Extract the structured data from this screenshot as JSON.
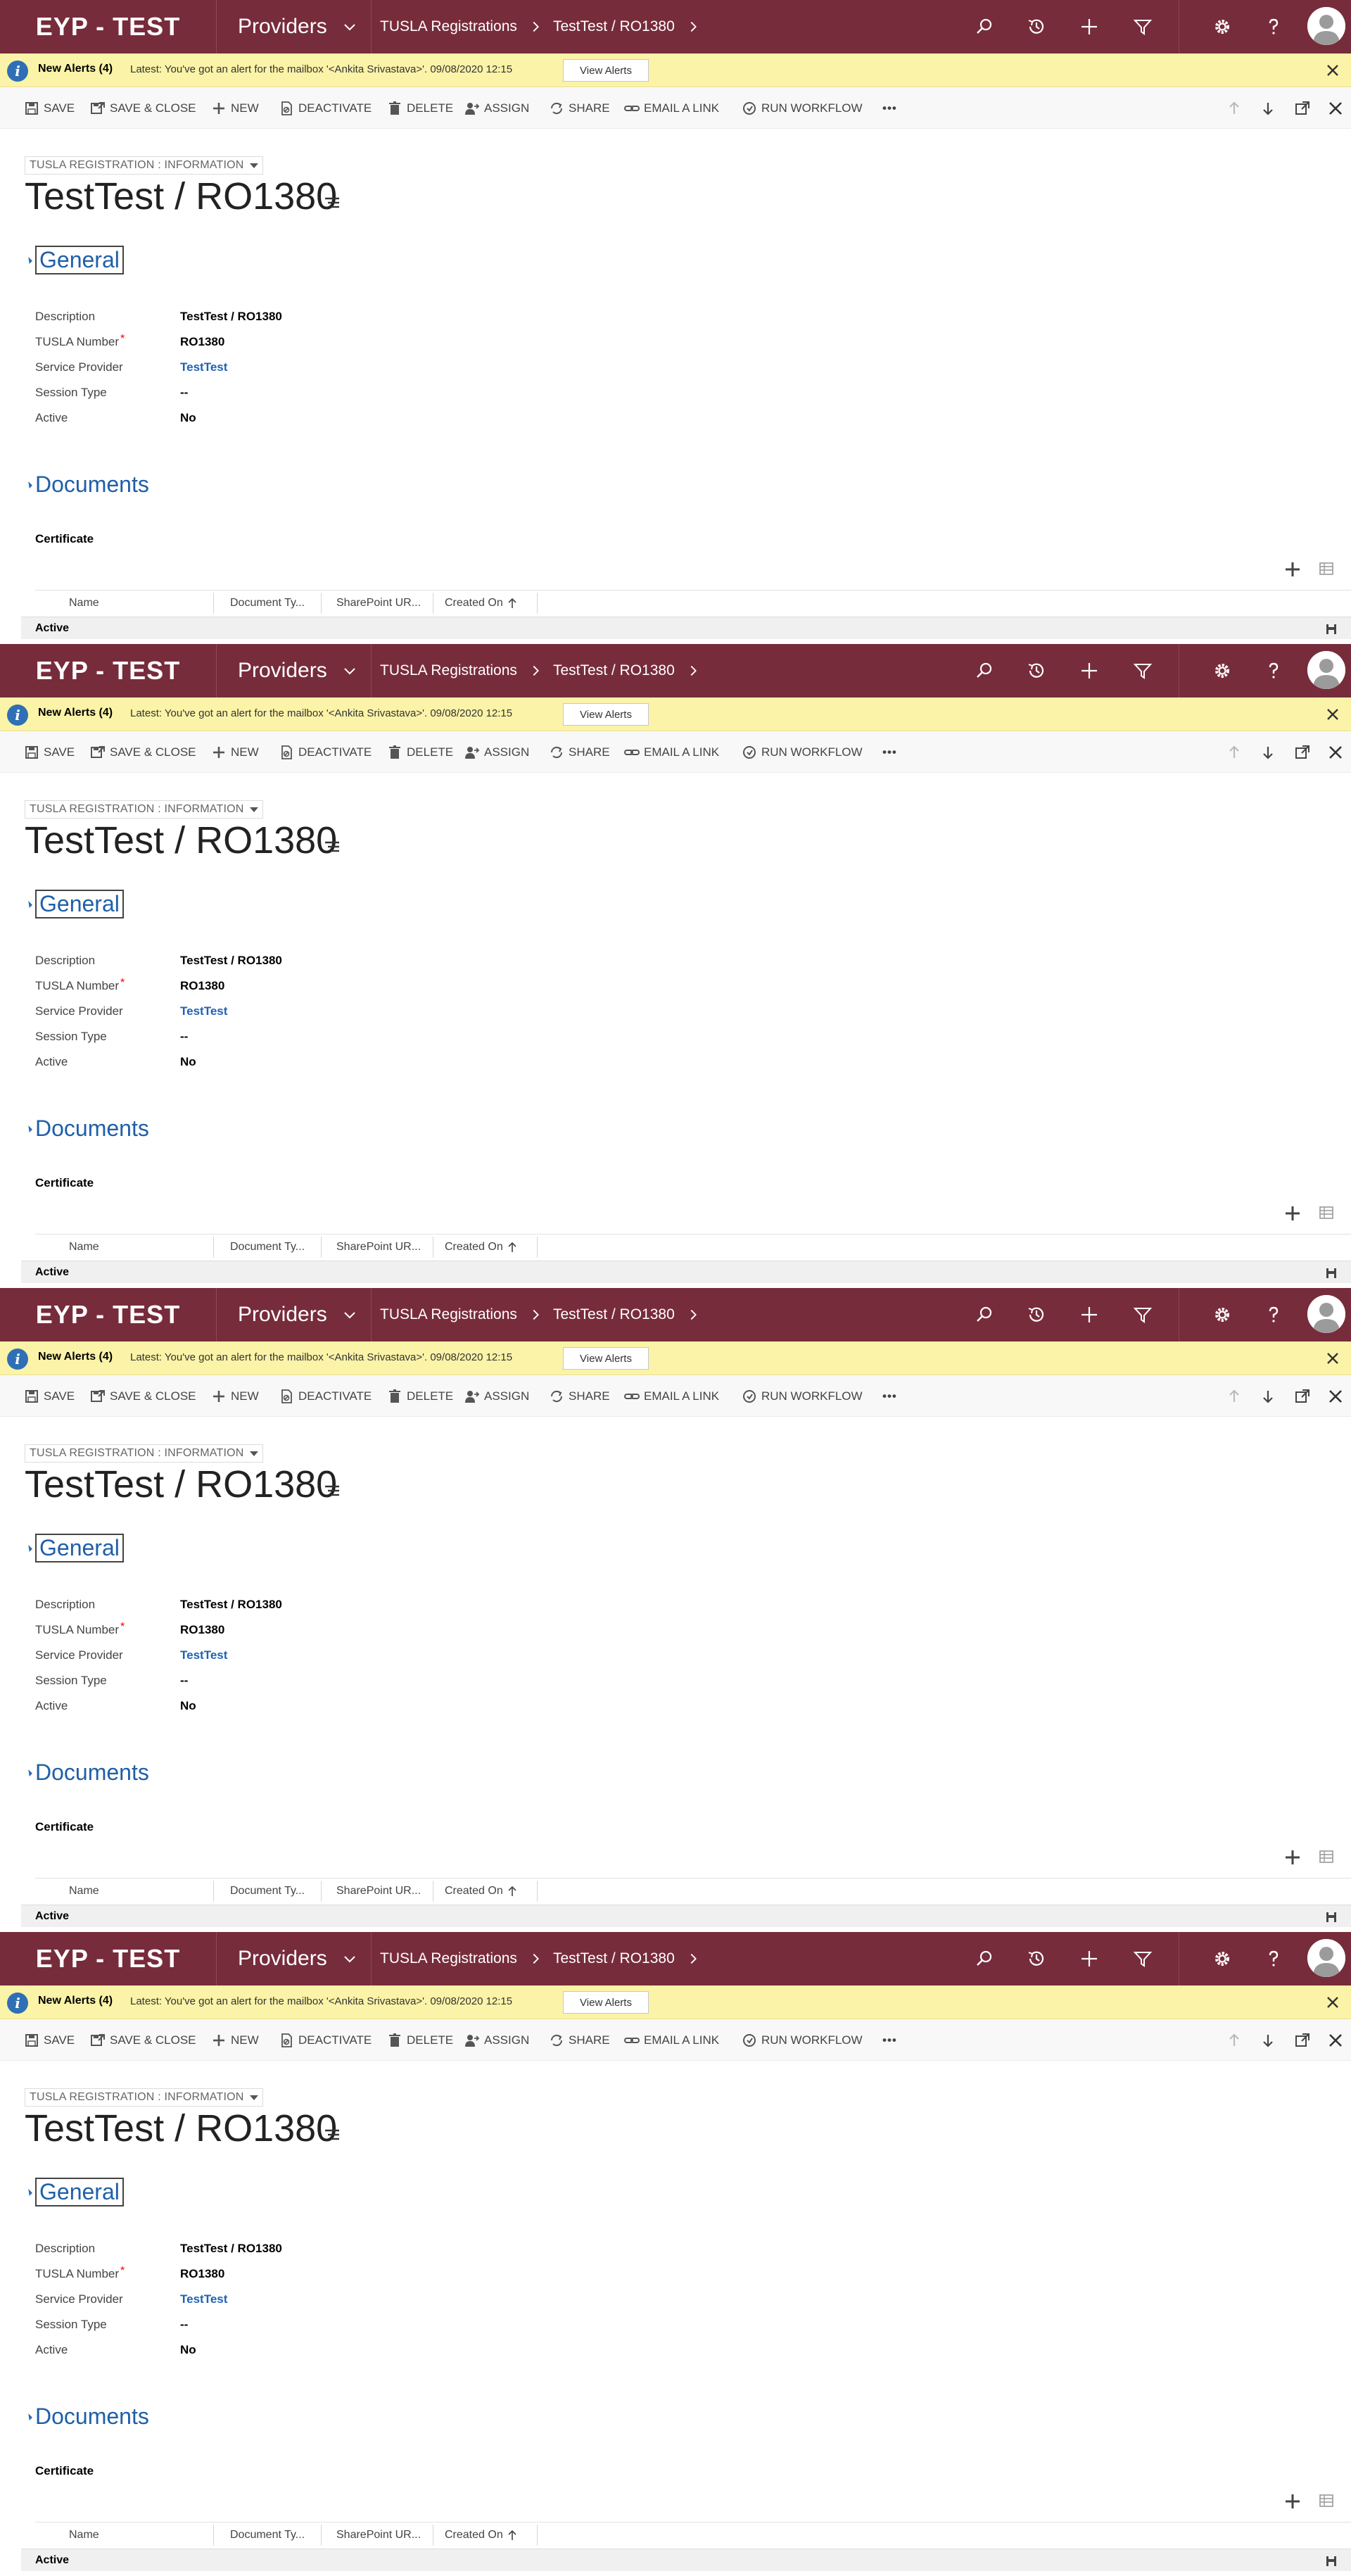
{
  "nav": {
    "brand": "EYP - TEST",
    "area": "Providers",
    "breadcrumb_entity": "TUSLA Registrations",
    "breadcrumb_record": "TestTest / RO1380",
    "icons": [
      "search-icon",
      "recent-icon",
      "create-icon",
      "advanced-find-icon",
      "settings-icon",
      "help-icon",
      "user-avatar"
    ]
  },
  "alert": {
    "title": "New Alerts (4)",
    "message": "Latest: You've got an alert for the mailbox '<Ankita Srivastava>'. 09/08/2020 12:15",
    "button": "View Alerts"
  },
  "commands": {
    "save": "SAVE",
    "save_close": "SAVE & CLOSE",
    "new": "NEW",
    "deactivate": "DEACTIVATE",
    "delete": "DELETE",
    "assign": "ASSIGN",
    "share": "SHARE",
    "email_link": "EMAIL A LINK",
    "run_workflow": "RUN WORKFLOW",
    "more": "•••"
  },
  "form": {
    "selector": "TUSLA REGISTRATION : INFORMATION",
    "title": "TestTest / RO1380",
    "general": {
      "heading": "General",
      "fields": [
        {
          "label": "Description",
          "value": "TestTest / RO1380"
        },
        {
          "label": "TUSLA Number",
          "value": "RO1380",
          "required": true
        },
        {
          "label": "Service Provider",
          "value": "TestTest",
          "link": true
        },
        {
          "label": "Session Type",
          "value": "--"
        },
        {
          "label": "Active",
          "value": "No"
        }
      ]
    },
    "documents": {
      "heading": "Documents",
      "subgrid_title": "Certificate",
      "columns": [
        "Name",
        "Document Ty...",
        "SharePoint UR...",
        "Created On"
      ]
    }
  },
  "status": {
    "text": "Active"
  },
  "colors": {
    "nav_bg": "#772c3b",
    "alert_bg": "#fbf3a7",
    "link": "#1e62b6",
    "section_title": "#1f5fa8"
  }
}
